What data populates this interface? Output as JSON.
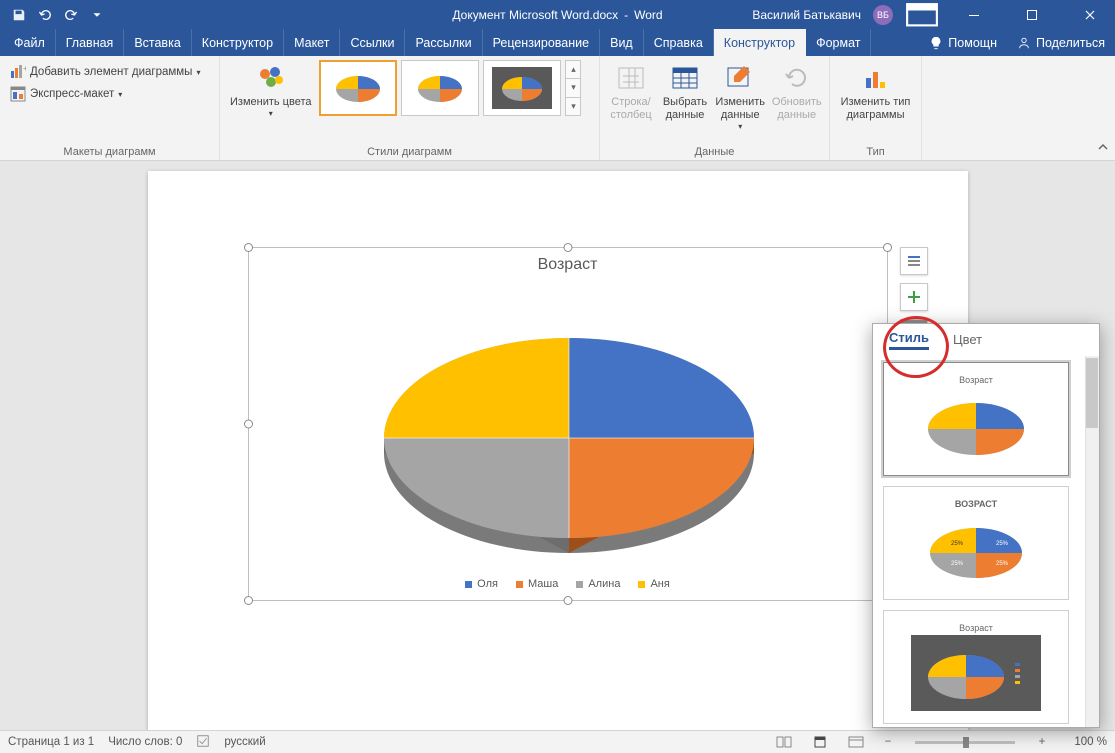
{
  "titlebar": {
    "doc_name": "Документ Microsoft Word.docx",
    "app_name": "Word",
    "user_name": "Василий Батькавич",
    "user_initials": "ВБ"
  },
  "tabs": {
    "file": "Файл",
    "home": "Главная",
    "insert": "Вставка",
    "constructor1": "Конструктор",
    "layout": "Макет",
    "references": "Ссылки",
    "mailings": "Рассылки",
    "review": "Рецензирование",
    "view": "Вид",
    "help": "Справка",
    "chart_design": "Конструктор",
    "chart_format": "Формат",
    "tell_me": "Помощн",
    "share": "Поделиться"
  },
  "ribbon": {
    "group_layouts": "Макеты диаграмм",
    "add_element": "Добавить элемент диаграммы",
    "quick_layout": "Экспресс-макет",
    "change_colors": "Изменить цвета",
    "group_styles": "Стили диаграмм",
    "group_data": "Данные",
    "switch_rowcol": "Строка/ столбец",
    "select_data": "Выбрать данные",
    "edit_data": "Изменить данные",
    "refresh_data": "Обновить данные",
    "group_type": "Тип",
    "change_type": "Изменить тип диаграммы"
  },
  "chart_data": {
    "type": "pie",
    "title": "Возраст",
    "categories": [
      "Оля",
      "Маша",
      "Алина",
      "Аня"
    ],
    "values": [
      25,
      25,
      25,
      25
    ],
    "colors": [
      "#4472c4",
      "#ed7d31",
      "#a5a5a5",
      "#ffc000"
    ]
  },
  "flyout": {
    "tab_style": "Стиль",
    "tab_color": "Цвет",
    "item_title1": "Возраст",
    "item_title2": "ВОЗРАСТ",
    "item_title3": "Возраст"
  },
  "status": {
    "page": "Страница 1 из 1",
    "words": "Число слов: 0",
    "lang": "русский",
    "zoom": "100 %"
  }
}
